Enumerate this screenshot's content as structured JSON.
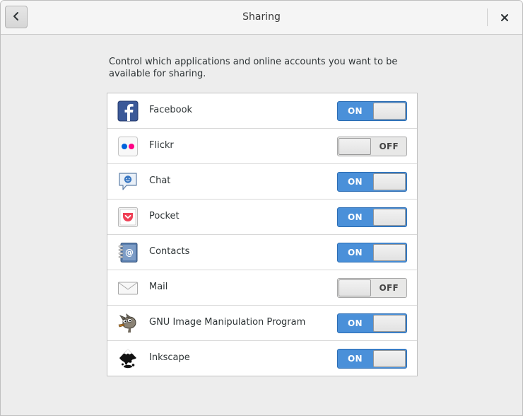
{
  "window": {
    "title": "Sharing",
    "back_icon": "chevron-left-icon",
    "close_icon": "close-icon"
  },
  "description": "Control which applications and online accounts you want to be available for sharing.",
  "apps": [
    {
      "name": "Facebook",
      "icon": "facebook-icon",
      "state": "ON",
      "enabled": true
    },
    {
      "name": "Flickr",
      "icon": "flickr-icon",
      "state": "OFF",
      "enabled": false
    },
    {
      "name": "Chat",
      "icon": "chat-icon",
      "state": "ON",
      "enabled": true
    },
    {
      "name": "Pocket",
      "icon": "pocket-icon",
      "state": "ON",
      "enabled": true
    },
    {
      "name": "Contacts",
      "icon": "contacts-icon",
      "state": "ON",
      "enabled": true
    },
    {
      "name": "Mail",
      "icon": "mail-icon",
      "state": "OFF",
      "enabled": false
    },
    {
      "name": "GNU Image Manipulation Program",
      "icon": "gimp-icon",
      "state": "ON",
      "enabled": true
    },
    {
      "name": "Inkscape",
      "icon": "inkscape-icon",
      "state": "ON",
      "enabled": true
    }
  ],
  "colors": {
    "switch_on": "#4a90d9",
    "switch_off": "#e8e8e7",
    "background": "#ededed"
  }
}
